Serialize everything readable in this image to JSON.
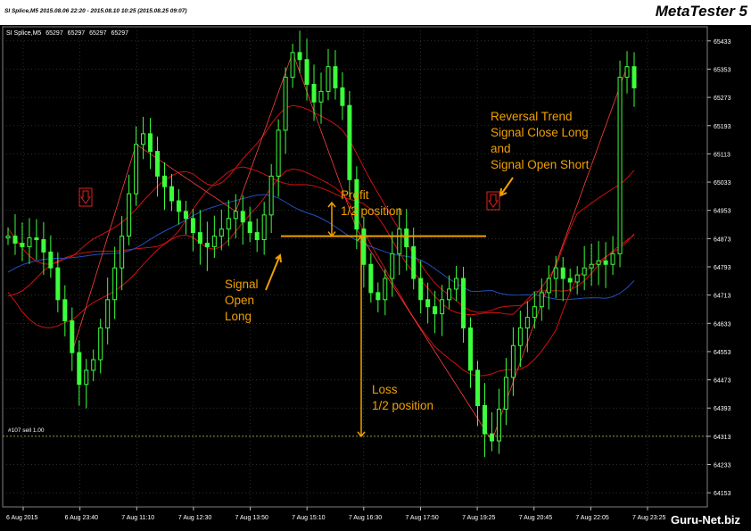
{
  "window": {
    "date_range": "SI Splice,M5   2015.08.06 22:20 - 2015.08.10 10:25 (2015.08.25 09:07)",
    "brand": "MetaTester 5"
  },
  "chart_header": {
    "symbol": "SI Splice,M5",
    "open": "65297",
    "high": "65297",
    "low": "65297",
    "close": "65297"
  },
  "trade_label": "#107 sell 1.00",
  "watermark": "Guru-Net.biz",
  "annotations": {
    "profit_line1": "Profit",
    "profit_line2": "1/2 position",
    "loss_line1": "Loss",
    "loss_line2": "1/2 position",
    "signal_long_1": "Signal",
    "signal_long_2": "Open",
    "signal_long_3": "Long",
    "reversal_1": "Reversal Trend",
    "reversal_2": "Signal Close Long",
    "reversal_3": "and",
    "reversal_4": "Signal Open Short"
  },
  "colors": {
    "background": "#000000",
    "grid": "#4a4a4a",
    "candle": "#3cff3c",
    "band": "#d01010",
    "annotation": "#f0a000",
    "blue_line": "#2050c0",
    "trade_level": "#c8c860"
  },
  "icons": [
    "arrow-down-box-icon",
    "arrow-down-box-icon"
  ],
  "chart_data": {
    "type": "candlestick",
    "y_ticks": [
      "65433",
      "65353",
      "65273",
      "65193",
      "65113",
      "65033",
      "64953",
      "64873",
      "64793",
      "64713",
      "64633",
      "64553",
      "64473",
      "64393",
      "64313",
      "64233",
      "64153"
    ],
    "x_ticks": [
      "6 Aug 2015",
      "6 Aug 23:40",
      "7 Aug 11:10",
      "7 Aug 12:30",
      "7 Aug 13:50",
      "7 Aug 15:10",
      "7 Aug 16:30",
      "7 Aug 17:50",
      "7 Aug 19:25",
      "7 Aug 20:45",
      "7 Aug 22:05",
      "7 Aug 23:25"
    ],
    "ylim": [
      64113,
      65473
    ],
    "series": [
      {
        "values": [
          64880,
          64860,
          64850,
          64875,
          64870,
          64835,
          64790,
          64700,
          64640,
          64550,
          64460,
          64500,
          64530,
          64620,
          64700,
          64790,
          64880,
          65000,
          65140,
          65170,
          65120,
          65050,
          65020,
          64980,
          64950,
          64930,
          64890,
          64860,
          64850,
          64880,
          64900,
          64930,
          64950,
          64920,
          64890,
          64870,
          64940,
          65050,
          65180,
          65330,
          65400,
          65380,
          65310,
          65260,
          65290,
          65360,
          65300,
          65250,
          65040,
          64900,
          64800,
          64720,
          64700,
          64760,
          64830,
          64900,
          64850,
          64760,
          64700,
          64680,
          64660,
          64700,
          64730,
          64760,
          64620,
          64500,
          64400,
          64320,
          64300,
          64390,
          64480,
          64570,
          64620,
          64650,
          64680,
          64720,
          64760,
          64790,
          64760,
          64750,
          64770,
          64790,
          64800,
          64810,
          64800,
          64830,
          65330,
          65360,
          65300
        ]
      }
    ]
  }
}
